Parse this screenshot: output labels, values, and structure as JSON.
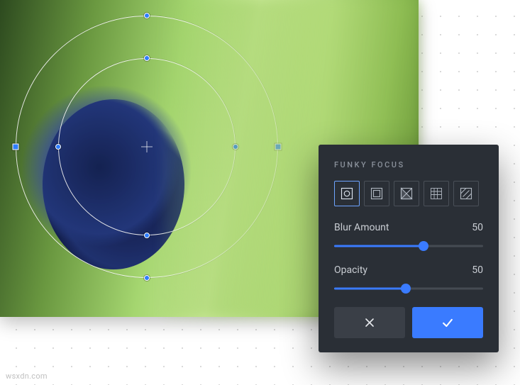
{
  "panel": {
    "title": "FUNKY FOCUS",
    "tools": [
      {
        "name": "radial-focus-icon",
        "active": true
      },
      {
        "name": "linear-focus-icon",
        "active": false
      },
      {
        "name": "half-focus-icon",
        "active": false
      },
      {
        "name": "grid-focus-icon",
        "active": false
      },
      {
        "name": "pattern-focus-icon",
        "active": false
      }
    ],
    "sliders": {
      "blur": {
        "label": "Blur Amount",
        "value": 50,
        "min": 0,
        "max": 100
      },
      "opacity": {
        "label": "Opacity",
        "value": 50,
        "min": 0,
        "max": 100
      }
    },
    "actions": {
      "cancel_icon": "close-icon",
      "confirm_icon": "check-icon"
    }
  },
  "colors": {
    "accent": "#3a7bff",
    "panel_bg": "#2a2f36",
    "text": "#c9cdd3",
    "muted": "#8a919b"
  },
  "watermark": "wsxdn.com"
}
